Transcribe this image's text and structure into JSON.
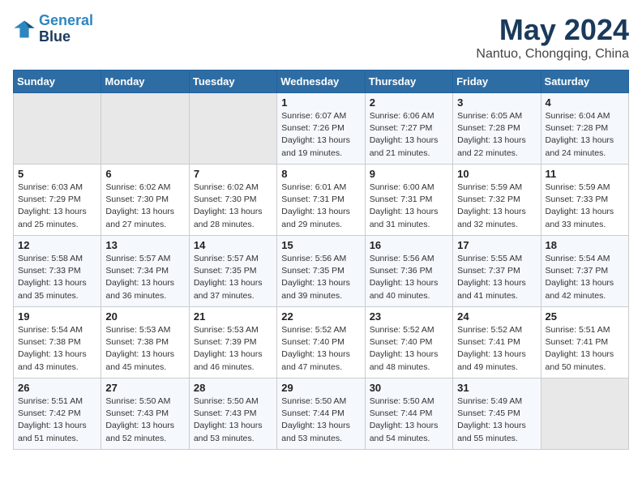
{
  "header": {
    "logo_line1": "General",
    "logo_line2": "Blue",
    "month_year": "May 2024",
    "location": "Nantuo, Chongqing, China"
  },
  "days_of_week": [
    "Sunday",
    "Monday",
    "Tuesday",
    "Wednesday",
    "Thursday",
    "Friday",
    "Saturday"
  ],
  "weeks": [
    [
      {
        "day": "",
        "info": ""
      },
      {
        "day": "",
        "info": ""
      },
      {
        "day": "",
        "info": ""
      },
      {
        "day": "1",
        "info": "Sunrise: 6:07 AM\nSunset: 7:26 PM\nDaylight: 13 hours\nand 19 minutes."
      },
      {
        "day": "2",
        "info": "Sunrise: 6:06 AM\nSunset: 7:27 PM\nDaylight: 13 hours\nand 21 minutes."
      },
      {
        "day": "3",
        "info": "Sunrise: 6:05 AM\nSunset: 7:28 PM\nDaylight: 13 hours\nand 22 minutes."
      },
      {
        "day": "4",
        "info": "Sunrise: 6:04 AM\nSunset: 7:28 PM\nDaylight: 13 hours\nand 24 minutes."
      }
    ],
    [
      {
        "day": "5",
        "info": "Sunrise: 6:03 AM\nSunset: 7:29 PM\nDaylight: 13 hours\nand 25 minutes."
      },
      {
        "day": "6",
        "info": "Sunrise: 6:02 AM\nSunset: 7:30 PM\nDaylight: 13 hours\nand 27 minutes."
      },
      {
        "day": "7",
        "info": "Sunrise: 6:02 AM\nSunset: 7:30 PM\nDaylight: 13 hours\nand 28 minutes."
      },
      {
        "day": "8",
        "info": "Sunrise: 6:01 AM\nSunset: 7:31 PM\nDaylight: 13 hours\nand 29 minutes."
      },
      {
        "day": "9",
        "info": "Sunrise: 6:00 AM\nSunset: 7:31 PM\nDaylight: 13 hours\nand 31 minutes."
      },
      {
        "day": "10",
        "info": "Sunrise: 5:59 AM\nSunset: 7:32 PM\nDaylight: 13 hours\nand 32 minutes."
      },
      {
        "day": "11",
        "info": "Sunrise: 5:59 AM\nSunset: 7:33 PM\nDaylight: 13 hours\nand 33 minutes."
      }
    ],
    [
      {
        "day": "12",
        "info": "Sunrise: 5:58 AM\nSunset: 7:33 PM\nDaylight: 13 hours\nand 35 minutes."
      },
      {
        "day": "13",
        "info": "Sunrise: 5:57 AM\nSunset: 7:34 PM\nDaylight: 13 hours\nand 36 minutes."
      },
      {
        "day": "14",
        "info": "Sunrise: 5:57 AM\nSunset: 7:35 PM\nDaylight: 13 hours\nand 37 minutes."
      },
      {
        "day": "15",
        "info": "Sunrise: 5:56 AM\nSunset: 7:35 PM\nDaylight: 13 hours\nand 39 minutes."
      },
      {
        "day": "16",
        "info": "Sunrise: 5:56 AM\nSunset: 7:36 PM\nDaylight: 13 hours\nand 40 minutes."
      },
      {
        "day": "17",
        "info": "Sunrise: 5:55 AM\nSunset: 7:37 PM\nDaylight: 13 hours\nand 41 minutes."
      },
      {
        "day": "18",
        "info": "Sunrise: 5:54 AM\nSunset: 7:37 PM\nDaylight: 13 hours\nand 42 minutes."
      }
    ],
    [
      {
        "day": "19",
        "info": "Sunrise: 5:54 AM\nSunset: 7:38 PM\nDaylight: 13 hours\nand 43 minutes."
      },
      {
        "day": "20",
        "info": "Sunrise: 5:53 AM\nSunset: 7:38 PM\nDaylight: 13 hours\nand 45 minutes."
      },
      {
        "day": "21",
        "info": "Sunrise: 5:53 AM\nSunset: 7:39 PM\nDaylight: 13 hours\nand 46 minutes."
      },
      {
        "day": "22",
        "info": "Sunrise: 5:52 AM\nSunset: 7:40 PM\nDaylight: 13 hours\nand 47 minutes."
      },
      {
        "day": "23",
        "info": "Sunrise: 5:52 AM\nSunset: 7:40 PM\nDaylight: 13 hours\nand 48 minutes."
      },
      {
        "day": "24",
        "info": "Sunrise: 5:52 AM\nSunset: 7:41 PM\nDaylight: 13 hours\nand 49 minutes."
      },
      {
        "day": "25",
        "info": "Sunrise: 5:51 AM\nSunset: 7:41 PM\nDaylight: 13 hours\nand 50 minutes."
      }
    ],
    [
      {
        "day": "26",
        "info": "Sunrise: 5:51 AM\nSunset: 7:42 PM\nDaylight: 13 hours\nand 51 minutes."
      },
      {
        "day": "27",
        "info": "Sunrise: 5:50 AM\nSunset: 7:43 PM\nDaylight: 13 hours\nand 52 minutes."
      },
      {
        "day": "28",
        "info": "Sunrise: 5:50 AM\nSunset: 7:43 PM\nDaylight: 13 hours\nand 53 minutes."
      },
      {
        "day": "29",
        "info": "Sunrise: 5:50 AM\nSunset: 7:44 PM\nDaylight: 13 hours\nand 53 minutes."
      },
      {
        "day": "30",
        "info": "Sunrise: 5:50 AM\nSunset: 7:44 PM\nDaylight: 13 hours\nand 54 minutes."
      },
      {
        "day": "31",
        "info": "Sunrise: 5:49 AM\nSunset: 7:45 PM\nDaylight: 13 hours\nand 55 minutes."
      },
      {
        "day": "",
        "info": ""
      }
    ]
  ]
}
